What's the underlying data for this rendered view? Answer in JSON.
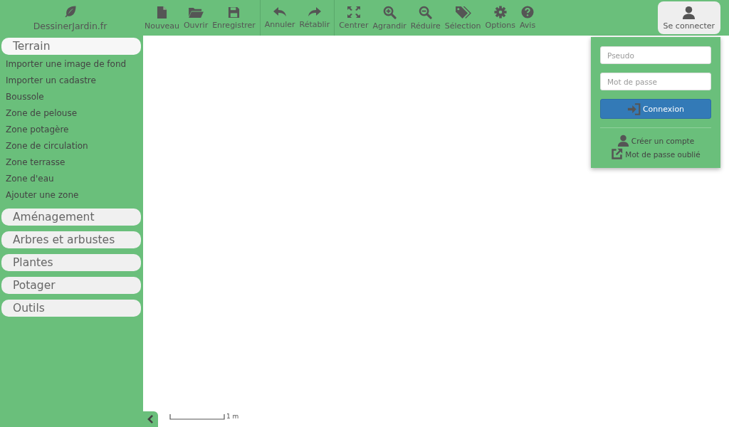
{
  "logo": {
    "text": "DessinerJardin.fr"
  },
  "toolbar_groups": [
    [
      {
        "kind": "new",
        "label": "Nouveau"
      },
      {
        "kind": "open",
        "label": "Ouvrir"
      },
      {
        "kind": "save",
        "label": "Enregistrer"
      }
    ],
    [
      {
        "kind": "undo",
        "label": "Annuler"
      },
      {
        "kind": "redo",
        "label": "Rétablir"
      }
    ],
    [
      {
        "kind": "fit",
        "label": "Centrer"
      },
      {
        "kind": "zoom-in",
        "label": "Agrandir"
      },
      {
        "kind": "zoom-out",
        "label": "Réduire"
      },
      {
        "kind": "tags",
        "label": "Sélection"
      },
      {
        "kind": "gear",
        "label": "Options"
      },
      {
        "kind": "help",
        "label": "Avis"
      }
    ]
  ],
  "login_button": {
    "label": "Se connecter",
    "selected": true
  },
  "sidebar": {
    "sections": [
      {
        "title": "Terrain",
        "items": [
          "Importer une image de fond",
          "Importer un cadastre",
          "Boussole",
          "Zone de pelouse",
          "Zone potagère",
          "Zone de circulation",
          "Zone terrasse",
          "Zone d'eau",
          "Ajouter une zone"
        ]
      },
      {
        "title": "Aménagement"
      },
      {
        "title": "Arbres et arbustes"
      },
      {
        "title": "Plantes"
      },
      {
        "title": "Potager"
      },
      {
        "title": "Outils"
      }
    ]
  },
  "scale": {
    "label": "1 m"
  },
  "login_panel": {
    "username": {
      "placeholder": "Pseudo"
    },
    "password": {
      "placeholder": "Mot de passe"
    },
    "submit": "Connexion",
    "links": [
      {
        "kind": "account",
        "label": "Créer un compte"
      },
      {
        "kind": "forgot",
        "label": "Mot de passe oublié"
      }
    ]
  }
}
